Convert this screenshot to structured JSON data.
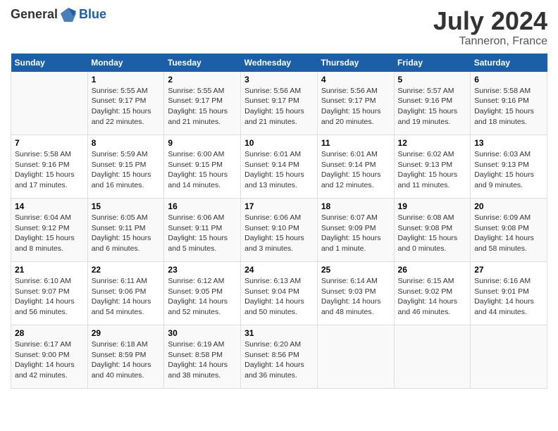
{
  "header": {
    "logo_general": "General",
    "logo_blue": "Blue",
    "title": "July 2024",
    "subtitle": "Tanneron, France"
  },
  "calendar": {
    "days_of_week": [
      "Sunday",
      "Monday",
      "Tuesday",
      "Wednesday",
      "Thursday",
      "Friday",
      "Saturday"
    ],
    "weeks": [
      [
        {
          "day": "",
          "info": ""
        },
        {
          "day": "1",
          "info": "Sunrise: 5:55 AM\nSunset: 9:17 PM\nDaylight: 15 hours\nand 22 minutes."
        },
        {
          "day": "2",
          "info": "Sunrise: 5:55 AM\nSunset: 9:17 PM\nDaylight: 15 hours\nand 21 minutes."
        },
        {
          "day": "3",
          "info": "Sunrise: 5:56 AM\nSunset: 9:17 PM\nDaylight: 15 hours\nand 21 minutes."
        },
        {
          "day": "4",
          "info": "Sunrise: 5:56 AM\nSunset: 9:17 PM\nDaylight: 15 hours\nand 20 minutes."
        },
        {
          "day": "5",
          "info": "Sunrise: 5:57 AM\nSunset: 9:16 PM\nDaylight: 15 hours\nand 19 minutes."
        },
        {
          "day": "6",
          "info": "Sunrise: 5:58 AM\nSunset: 9:16 PM\nDaylight: 15 hours\nand 18 minutes."
        }
      ],
      [
        {
          "day": "7",
          "info": "Sunrise: 5:58 AM\nSunset: 9:16 PM\nDaylight: 15 hours\nand 17 minutes."
        },
        {
          "day": "8",
          "info": "Sunrise: 5:59 AM\nSunset: 9:15 PM\nDaylight: 15 hours\nand 16 minutes."
        },
        {
          "day": "9",
          "info": "Sunrise: 6:00 AM\nSunset: 9:15 PM\nDaylight: 15 hours\nand 14 minutes."
        },
        {
          "day": "10",
          "info": "Sunrise: 6:01 AM\nSunset: 9:14 PM\nDaylight: 15 hours\nand 13 minutes."
        },
        {
          "day": "11",
          "info": "Sunrise: 6:01 AM\nSunset: 9:14 PM\nDaylight: 15 hours\nand 12 minutes."
        },
        {
          "day": "12",
          "info": "Sunrise: 6:02 AM\nSunset: 9:13 PM\nDaylight: 15 hours\nand 11 minutes."
        },
        {
          "day": "13",
          "info": "Sunrise: 6:03 AM\nSunset: 9:13 PM\nDaylight: 15 hours\nand 9 minutes."
        }
      ],
      [
        {
          "day": "14",
          "info": "Sunrise: 6:04 AM\nSunset: 9:12 PM\nDaylight: 15 hours\nand 8 minutes."
        },
        {
          "day": "15",
          "info": "Sunrise: 6:05 AM\nSunset: 9:11 PM\nDaylight: 15 hours\nand 6 minutes."
        },
        {
          "day": "16",
          "info": "Sunrise: 6:06 AM\nSunset: 9:11 PM\nDaylight: 15 hours\nand 5 minutes."
        },
        {
          "day": "17",
          "info": "Sunrise: 6:06 AM\nSunset: 9:10 PM\nDaylight: 15 hours\nand 3 minutes."
        },
        {
          "day": "18",
          "info": "Sunrise: 6:07 AM\nSunset: 9:09 PM\nDaylight: 15 hours\nand 1 minute."
        },
        {
          "day": "19",
          "info": "Sunrise: 6:08 AM\nSunset: 9:08 PM\nDaylight: 15 hours\nand 0 minutes."
        },
        {
          "day": "20",
          "info": "Sunrise: 6:09 AM\nSunset: 9:08 PM\nDaylight: 14 hours\nand 58 minutes."
        }
      ],
      [
        {
          "day": "21",
          "info": "Sunrise: 6:10 AM\nSunset: 9:07 PM\nDaylight: 14 hours\nand 56 minutes."
        },
        {
          "day": "22",
          "info": "Sunrise: 6:11 AM\nSunset: 9:06 PM\nDaylight: 14 hours\nand 54 minutes."
        },
        {
          "day": "23",
          "info": "Sunrise: 6:12 AM\nSunset: 9:05 PM\nDaylight: 14 hours\nand 52 minutes."
        },
        {
          "day": "24",
          "info": "Sunrise: 6:13 AM\nSunset: 9:04 PM\nDaylight: 14 hours\nand 50 minutes."
        },
        {
          "day": "25",
          "info": "Sunrise: 6:14 AM\nSunset: 9:03 PM\nDaylight: 14 hours\nand 48 minutes."
        },
        {
          "day": "26",
          "info": "Sunrise: 6:15 AM\nSunset: 9:02 PM\nDaylight: 14 hours\nand 46 minutes."
        },
        {
          "day": "27",
          "info": "Sunrise: 6:16 AM\nSunset: 9:01 PM\nDaylight: 14 hours\nand 44 minutes."
        }
      ],
      [
        {
          "day": "28",
          "info": "Sunrise: 6:17 AM\nSunset: 9:00 PM\nDaylight: 14 hours\nand 42 minutes."
        },
        {
          "day": "29",
          "info": "Sunrise: 6:18 AM\nSunset: 8:59 PM\nDaylight: 14 hours\nand 40 minutes."
        },
        {
          "day": "30",
          "info": "Sunrise: 6:19 AM\nSunset: 8:58 PM\nDaylight: 14 hours\nand 38 minutes."
        },
        {
          "day": "31",
          "info": "Sunrise: 6:20 AM\nSunset: 8:56 PM\nDaylight: 14 hours\nand 36 minutes."
        },
        {
          "day": "",
          "info": ""
        },
        {
          "day": "",
          "info": ""
        },
        {
          "day": "",
          "info": ""
        }
      ]
    ]
  }
}
